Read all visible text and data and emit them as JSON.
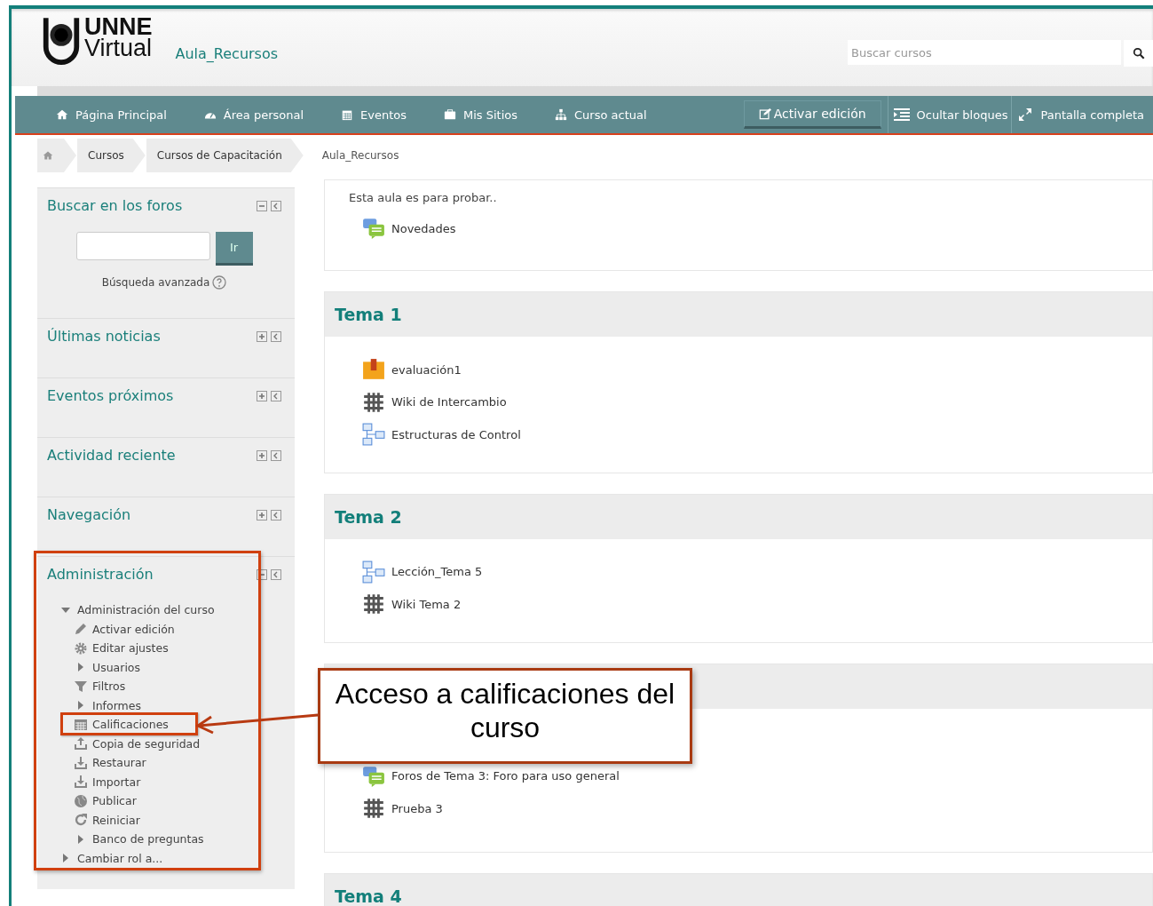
{
  "header": {
    "logo": {
      "line1": "UNNE",
      "line2": "Virtual"
    },
    "course_title": "Aula_Recursos",
    "search": {
      "placeholder": "Buscar cursos"
    }
  },
  "navbar": {
    "items": [
      {
        "label": "Página Principal"
      },
      {
        "label": "Área personal"
      },
      {
        "label": "Eventos"
      },
      {
        "label": "Mis Sitios"
      },
      {
        "label": "Curso actual"
      }
    ],
    "edit_button": "Activar edición",
    "actions": [
      {
        "label": "Ocultar bloques"
      },
      {
        "label": "Pantalla completa"
      }
    ]
  },
  "breadcrumb": [
    "Cursos",
    "Cursos de Capacitación",
    "Aula_Recursos"
  ],
  "blocks": [
    {
      "kind": "search",
      "title": "Buscar en los foros",
      "expanded": true,
      "button": "Ir",
      "link": "Búsqueda avanzada"
    },
    {
      "kind": "plain",
      "title": "Últimas noticias",
      "expanded": false
    },
    {
      "kind": "plain",
      "title": "Eventos próximos",
      "expanded": false
    },
    {
      "kind": "plain",
      "title": "Actividad reciente",
      "expanded": false
    },
    {
      "kind": "plain",
      "title": "Navegación",
      "expanded": false
    },
    {
      "kind": "tree",
      "title": "Administración",
      "expanded": true,
      "tree": [
        {
          "label": "Administración del curso",
          "expanded": true,
          "children": [
            {
              "label": "Activar edición",
              "kind": "pencil"
            },
            {
              "label": "Editar ajustes",
              "kind": "gear"
            },
            {
              "label": "Usuarios",
              "kind": "folder",
              "expanded": false
            },
            {
              "label": "Filtros",
              "kind": "filter"
            },
            {
              "label": "Informes",
              "kind": "folder",
              "expanded": false
            },
            {
              "label": "Calificaciones",
              "kind": "table"
            },
            {
              "label": "Copia de seguridad",
              "kind": "upload"
            },
            {
              "label": "Restaurar",
              "kind": "download"
            },
            {
              "label": "Importar",
              "kind": "download"
            },
            {
              "label": "Publicar",
              "kind": "globe"
            },
            {
              "label": "Reiniciar",
              "kind": "refresh"
            },
            {
              "label": "Banco de preguntas",
              "kind": "folder",
              "expanded": false
            }
          ]
        },
        {
          "label": "Cambiar rol a...",
          "expanded": false
        }
      ]
    }
  ],
  "intro": {
    "text": "Esta aula es para probar..",
    "activities": [
      {
        "kind": "forum",
        "name": "Novedades"
      }
    ]
  },
  "sections": [
    {
      "title": "Tema 1",
      "activities": [
        {
          "kind": "quiz",
          "name": "evaluación1"
        },
        {
          "kind": "wiki",
          "name": "Wiki de Intercambio"
        },
        {
          "kind": "lesson",
          "name": "Estructuras de Control"
        }
      ]
    },
    {
      "title": "Tema 2",
      "activities": [
        {
          "kind": "lesson",
          "name": "Lección_Tema 5"
        },
        {
          "kind": "wiki",
          "name": "Wiki Tema 2"
        }
      ]
    },
    {
      "activities": [
        {
          "kind": "forum",
          "name": "Foros de Tema 3: Foro para uso general"
        },
        {
          "kind": "wiki",
          "name": "Prueba 3"
        }
      ]
    },
    {
      "title": "Tema 4"
    }
  ],
  "annotation": {
    "text": "Acceso a calificaciones del curso"
  }
}
